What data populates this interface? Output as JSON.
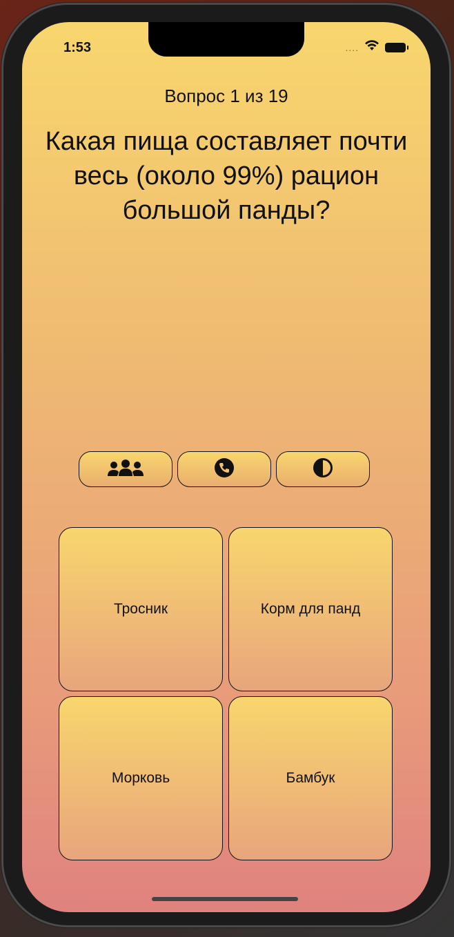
{
  "status_bar": {
    "time": "1:53",
    "signal": "....",
    "icons": [
      "wifi-icon",
      "battery-icon"
    ]
  },
  "quiz": {
    "counter": "Вопрос 1 из 19",
    "question": "Какая пища составляет почти весь (около 99%) рацион большой панды?"
  },
  "lifelines": [
    {
      "icon": "audience-icon"
    },
    {
      "icon": "phone-call-icon"
    },
    {
      "icon": "fifty-fifty-icon"
    }
  ],
  "answers": [
    {
      "label": "Тросник"
    },
    {
      "label": "Корм для панд"
    },
    {
      "label": "Морковь"
    },
    {
      "label": "Бамбук"
    }
  ],
  "colors": {
    "gradient_top": "#f8d66d",
    "gradient_bottom": "#e0827f",
    "text": "#111111"
  }
}
